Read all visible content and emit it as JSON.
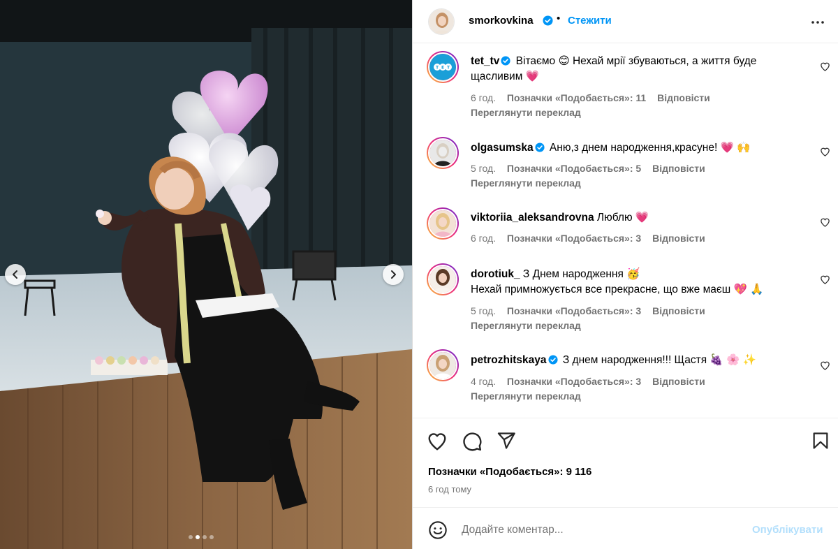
{
  "post": {
    "photo_description_icons": [
      "chevron-left-icon",
      "chevron-right-icon"
    ],
    "carousel": {
      "count": 4,
      "active_index": 1
    }
  },
  "header": {
    "username": "smorkovkina",
    "separator": "•",
    "follow_label": "Стежити"
  },
  "comments": [
    {
      "username": "tet_tv",
      "verified": true,
      "text": " Вітаємо 😊  Нехай мрії збуваються, а життя буде щасливим 💗",
      "time": "6 год.",
      "likes": "Позначки «Подобається»: 11",
      "reply": "Відповісти",
      "translate": "Переглянути переклад"
    },
    {
      "username": "olgasumska",
      "verified": true,
      "text": " Аню,з днем народження,красуне! 💗 🙌",
      "time": "5 год.",
      "likes": "Позначки «Подобається»: 5",
      "reply": "Відповісти",
      "translate": "Переглянути переклад"
    },
    {
      "username": "viktoriia_aleksandrovna",
      "verified": false,
      "text": " Люблю 💗",
      "time": "6 год.",
      "likes": "Позначки «Подобається»: 3",
      "reply": "Відповісти",
      "translate": ""
    },
    {
      "username": "dorotiuk_",
      "verified": false,
      "text": " З Днем народження 🥳",
      "text2": "Нехай примножується все прекрасне, що вже маєш 💖 🙏",
      "time": "5 год.",
      "likes": "Позначки «Подобається»: 3",
      "reply": "Відповісти",
      "translate": "Переглянути переклад"
    },
    {
      "username": "petrozhitskaya",
      "verified": true,
      "text": " З днем народження!!! Щастя  🍇 🌸 ✨",
      "time": "4 год.",
      "likes": "Позначки «Подобається»: 3",
      "reply": "Відповісти",
      "translate": "Переглянути переклад"
    }
  ],
  "actions": {
    "icons": [
      "heart-icon",
      "comment-icon",
      "share-icon",
      "bookmark-icon"
    ],
    "likes": "Позначки «Подобається»: 9 116",
    "time": "6 год тому"
  },
  "composer": {
    "placeholder": "Додайте коментар...",
    "value": "",
    "post_label": "Опублікувати"
  },
  "colors": {
    "accent": "#0095f6",
    "verified": "#0095f6",
    "muted": "#737373",
    "post_disabled": "#b2dffc",
    "balloon_pink": "#d99ae0"
  }
}
